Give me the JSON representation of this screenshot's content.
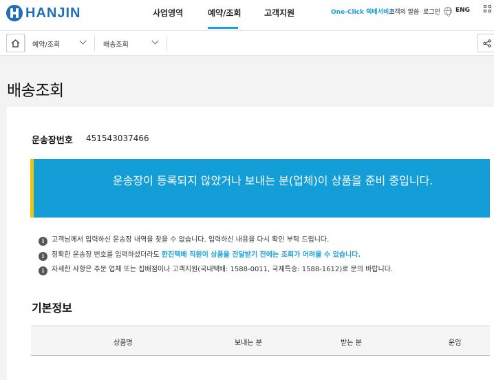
{
  "header": {
    "logo_text": "HANJIN",
    "nav": [
      "사업영역",
      "예약/조회",
      "고객지원"
    ],
    "active_nav": "예약/조회",
    "util": {
      "oneclick": "One-Click 택배서비스",
      "voice": "고객의 말씀",
      "login": "로그인",
      "lang": "ENG"
    }
  },
  "breadcrumb": {
    "level1": "예약/조회",
    "level2": "배송조회"
  },
  "page": {
    "title": "배송조회"
  },
  "invoice": {
    "label": "운송장번호",
    "number": "451543037466"
  },
  "status": {
    "message": "운송장이 등록되지 않았거나 보내는 분(업체)이 상품을 준비 중입니다."
  },
  "notes": [
    {
      "icon": "info-icon",
      "text": "고객님께서 입력하신 운송장 내역을 찾을 수 없습니다. 입력하신 내용을 다시 확인 부탁 드립니다."
    },
    {
      "icon": "info-icon",
      "text_pre": "정확한 운송장 번호를 입력하셨더라도 ",
      "text_hl": "한진택배 직원이 상품을 전달받기 전에는 조회가 어려울 수 있습니다."
    },
    {
      "icon": "info-icon",
      "text": "자세한 사항은 주문 업체 또는 집배점이나 고객지원(국내택배: 1588-0011, 국제특송: 1588-1612)로 문의 바랍니다."
    }
  ],
  "basic_info": {
    "title": "기본정보",
    "columns": [
      "상품명",
      "보내는 분",
      "받는 분",
      "운임"
    ]
  },
  "colors": {
    "brand": "#1f6fb8",
    "accent": "#1ba0d8",
    "status_bg": "#139ed7",
    "status_border": "#f3c300"
  }
}
